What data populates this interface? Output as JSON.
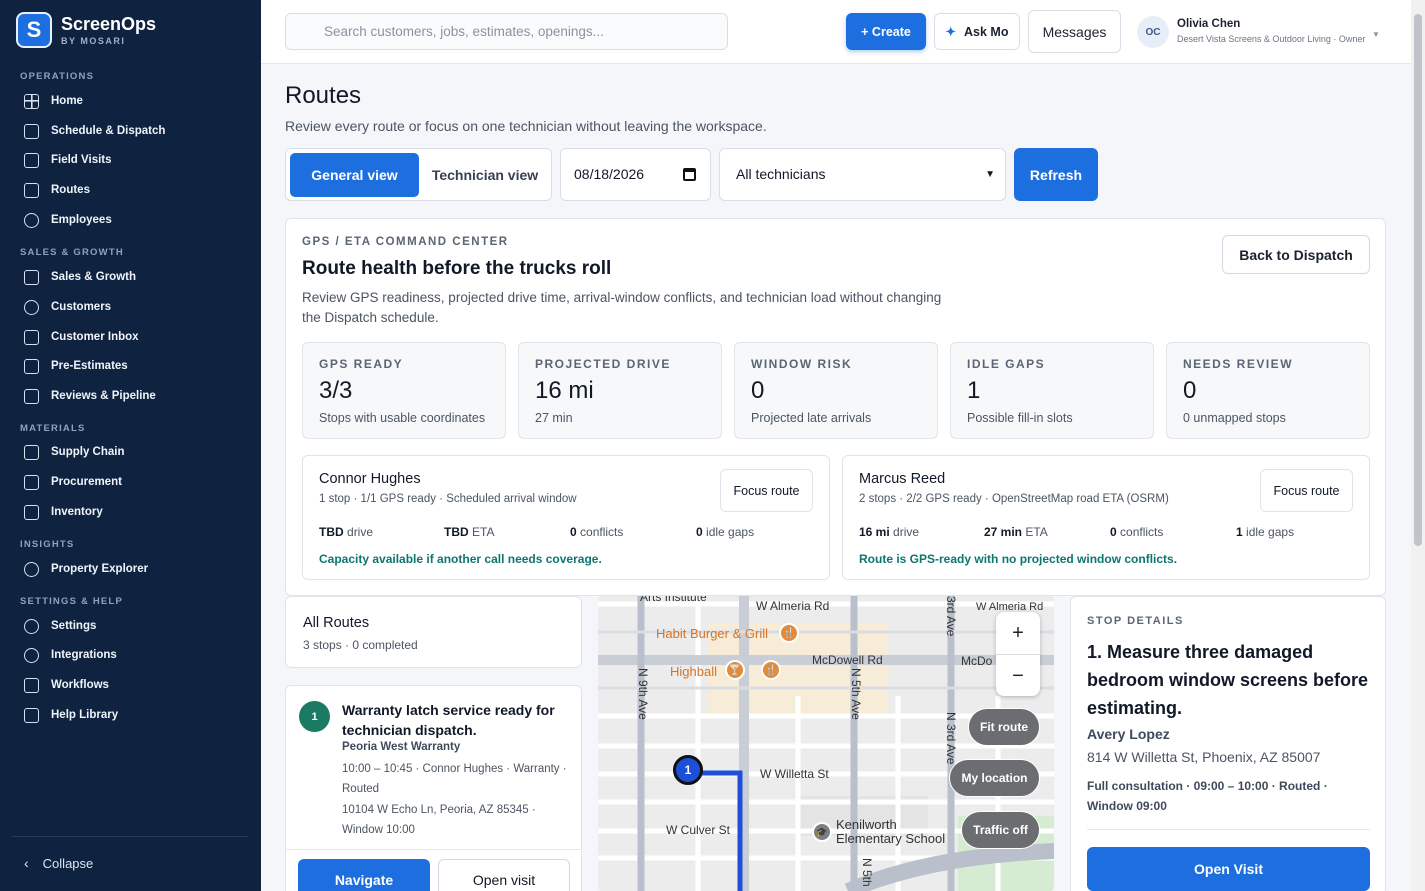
{
  "brand": {
    "name": "ScreenOps",
    "sub": "BY MOSARI",
    "logo_letter": "S"
  },
  "sidebar": {
    "sections": [
      {
        "label": "OPERATIONS"
      },
      {
        "label": "SALES & GROWTH"
      },
      {
        "label": "MATERIALS"
      },
      {
        "label": "INSIGHTS"
      },
      {
        "label": "SETTINGS & HELP"
      }
    ],
    "items": [
      {
        "label": "Home",
        "icon": "home-grid-icon"
      },
      {
        "label": "Schedule & Dispatch",
        "icon": "calendar-icon"
      },
      {
        "label": "Field Visits",
        "icon": "clipboard-icon"
      },
      {
        "label": "Routes",
        "icon": "cube-icon"
      },
      {
        "label": "Employees",
        "icon": "person-icon"
      },
      {
        "label": "Sales & Growth",
        "icon": "bar-chart-icon"
      },
      {
        "label": "Customers",
        "icon": "person-icon"
      },
      {
        "label": "Customer Inbox",
        "icon": "chat-icon"
      },
      {
        "label": "Pre-Estimates",
        "icon": "document-icon"
      },
      {
        "label": "Reviews & Pipeline",
        "icon": "trend-icon"
      },
      {
        "label": "Supply Chain",
        "icon": "warehouse-icon"
      },
      {
        "label": "Procurement",
        "icon": "cart-icon"
      },
      {
        "label": "Inventory",
        "icon": "box-icon"
      },
      {
        "label": "Property Explorer",
        "icon": "pin-icon"
      },
      {
        "label": "Settings",
        "icon": "gear-icon"
      },
      {
        "label": "Integrations",
        "icon": "plug-icon"
      },
      {
        "label": "Workflows",
        "icon": "workflow-icon"
      },
      {
        "label": "Help Library",
        "icon": "book-icon"
      }
    ],
    "collapse_label": "Collapse"
  },
  "topbar": {
    "search_placeholder": "Search customers, jobs, estimates, openings...",
    "create_label": "+ Create",
    "ask_label": "Ask Mo",
    "messages_label": "Messages",
    "user_initials": "OC",
    "user_name": "Olivia Chen",
    "user_org": "Desert Vista Screens & Outdoor Living · Owner"
  },
  "page": {
    "title": "Routes",
    "subtitle": "Review every route or focus on one technician without leaving the workspace."
  },
  "controls": {
    "general_view": "General view",
    "technician_view": "Technician view",
    "date": "08/18/2026",
    "technician_filter": "All technicians",
    "refresh": "Refresh"
  },
  "command_center": {
    "eyebrow": "GPS / ETA COMMAND CENTER",
    "title": "Route health before the trucks roll",
    "description": "Review GPS readiness, projected drive time, arrival-window conflicts, and technician load without changing the Dispatch schedule.",
    "back_label": "Back to Dispatch",
    "metrics": [
      {
        "label": "GPS READY",
        "value": "3/3",
        "sub": "Stops with usable coordinates"
      },
      {
        "label": "PROJECTED DRIVE",
        "value": "16 mi",
        "sub": "27 min"
      },
      {
        "label": "WINDOW RISK",
        "value": "0",
        "sub": "Projected late arrivals"
      },
      {
        "label": "IDLE GAPS",
        "value": "1",
        "sub": "Possible fill-in slots"
      },
      {
        "label": "NEEDS REVIEW",
        "value": "0",
        "sub": "0 unmapped stops"
      }
    ],
    "technicians": [
      {
        "name": "Connor Hughes",
        "sub": "1 stop · 1/1 GPS ready · Scheduled arrival window",
        "focus_label": "Focus route",
        "drive_value": "TBD",
        "drive_label": "drive",
        "eta_value": "TBD",
        "eta_label": "ETA",
        "conflicts_value": "0",
        "conflicts_label": "conflicts",
        "idle_value": "0",
        "idle_label": "idle gaps",
        "note": "Capacity available if another call needs coverage."
      },
      {
        "name": "Marcus Reed",
        "sub": "2 stops · 2/2 GPS ready · OpenStreetMap road ETA (OSRM)",
        "focus_label": "Focus route",
        "drive_value": "16 mi",
        "drive_label": "drive",
        "eta_value": "27 min",
        "eta_label": "ETA",
        "conflicts_value": "0",
        "conflicts_label": "conflicts",
        "idle_value": "1",
        "idle_label": "idle gaps",
        "note": "Route is GPS-ready with no projected window conflicts."
      }
    ]
  },
  "routes_list": {
    "title": "All Routes",
    "sub": "3 stops · 0 completed",
    "stop": {
      "number": "1",
      "title": "Warranty latch service ready for technician dispatch.",
      "client": "Peoria West Warranty",
      "meta": "10:00 – 10:45 · Connor Hughes · Warranty · Routed",
      "address": "10104 W Echo Ln, Peoria, AZ 85345 · Window 10:00",
      "navigate_label": "Navigate",
      "open_label": "Open visit"
    }
  },
  "map": {
    "labels": {
      "arts": "Arts Institute",
      "almeria": "W Almeria Rd",
      "almeria2": "W Almeria Rd",
      "mcdowell": "McDowell Rd",
      "mcdowell2": "McDo",
      "willetta": "W Willetta St",
      "culver": "W Culver St",
      "ninth": "N 9th Ave",
      "fifth": "N 5th Ave",
      "fifth2": "N 5th",
      "third": "N 3rd Ave",
      "third2": "3rd Ave",
      "habit": "Habit Burger & Grill",
      "highball": "Highball",
      "kenilworth": "Kenilworth",
      "kenilworth2": "Elementary School"
    },
    "marker_number": "1",
    "zoom_in": "+",
    "zoom_out": "−",
    "fit_route": "Fit route",
    "my_location": "My location",
    "traffic": "Traffic off"
  },
  "stop_details": {
    "eyebrow": "STOP DETAILS",
    "title": "1. Measure three damaged bedroom window screens before estimating.",
    "client": "Avery Lopez",
    "address": "814 W Willetta St, Phoenix, AZ 85007",
    "meta": "Full consultation · 09:00 – 10:00 · Routed · Window 09:00",
    "open_label": "Open Visit"
  },
  "colors": {
    "accent": "#1d6fe0",
    "sidebar": "#0f2340",
    "success": "#0f766e",
    "route_line": "#1d4fd8"
  }
}
